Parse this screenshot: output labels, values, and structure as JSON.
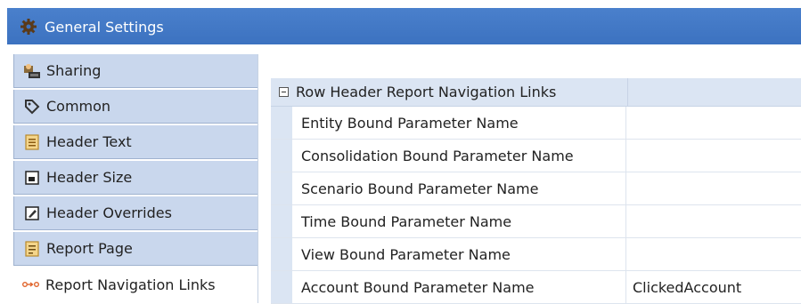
{
  "window": {
    "title": "General Settings",
    "icon": "gear-icon"
  },
  "sidebar": {
    "items": [
      {
        "label": "Sharing",
        "icon": "sharing-icon",
        "active": false
      },
      {
        "label": "Common",
        "icon": "tag-icon",
        "active": false
      },
      {
        "label": "Header Text",
        "icon": "header-text-icon",
        "active": false
      },
      {
        "label": "Header Size",
        "icon": "header-size-icon",
        "active": false
      },
      {
        "label": "Header Overrides",
        "icon": "header-overrides-icon",
        "active": false
      },
      {
        "label": "Report Page",
        "icon": "report-page-icon",
        "active": false
      },
      {
        "label": "Report Navigation Links",
        "icon": "navigation-links-icon",
        "active": true
      }
    ]
  },
  "section": {
    "title": "Row Header Report Navigation Links",
    "rows": [
      {
        "name": "Entity Bound Parameter Name",
        "value": ""
      },
      {
        "name": "Consolidation Bound Parameter Name",
        "value": ""
      },
      {
        "name": "Scenario Bound Parameter Name",
        "value": ""
      },
      {
        "name": "Time Bound Parameter Name",
        "value": ""
      },
      {
        "name": "View Bound Parameter Name",
        "value": ""
      },
      {
        "name": "Account Bound Parameter Name",
        "value": "ClickedAccount"
      }
    ]
  },
  "colors": {
    "title_bar": "#3c72c0",
    "nav_inactive": "#c9d7ed",
    "section_header": "#dbe5f3"
  }
}
